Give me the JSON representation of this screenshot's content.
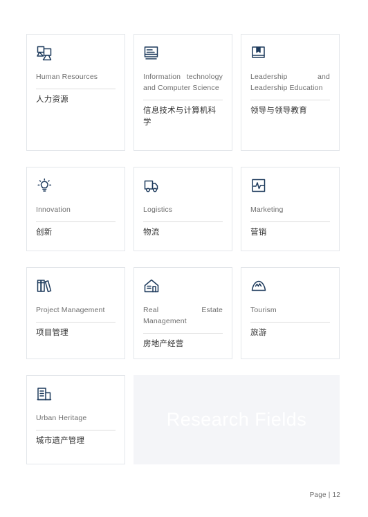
{
  "page": {
    "background_color": "#ffffff",
    "accent_color": "#1d3a5c",
    "title_en_color": "#6e6e6e",
    "title_zh_color": "#2e2e2e",
    "banner_background": "#f4f5f8",
    "banner_text_color": "#ffffff"
  },
  "cards": [
    {
      "icon": "users-group-icon",
      "title_en": "Human Resources",
      "title_zh": "人力资源"
    },
    {
      "icon": "computer-monitor-icon",
      "title_en": "Information technology and Computer Science",
      "title_zh": "信息技术与计算机科学"
    },
    {
      "icon": "book-bookmark-icon",
      "title_en": "Leadership and Leadership Education",
      "title_zh": "领导与领导教育"
    },
    {
      "icon": "lightbulb-icon",
      "title_en": "Innovation",
      "title_zh": "创新"
    },
    {
      "icon": "delivery-truck-icon",
      "title_en": "Logistics",
      "title_zh": "物流"
    },
    {
      "icon": "pulse-chart-icon",
      "title_en": "Marketing",
      "title_zh": "营销"
    },
    {
      "icon": "books-shelf-icon",
      "title_en": "Project Management",
      "title_zh": "项目管理"
    },
    {
      "icon": "house-icon",
      "title_en": "Real Estate Management",
      "title_zh": "房地产经营"
    },
    {
      "icon": "mountain-icon",
      "title_en": "Tourism",
      "title_zh": "旅游"
    },
    {
      "icon": "city-buildings-icon",
      "title_en": "Urban Heritage",
      "title_zh": "城市遗产管理"
    }
  ],
  "banner": {
    "label": "Research Fields"
  },
  "footer": {
    "page_label": "Page | 12"
  }
}
